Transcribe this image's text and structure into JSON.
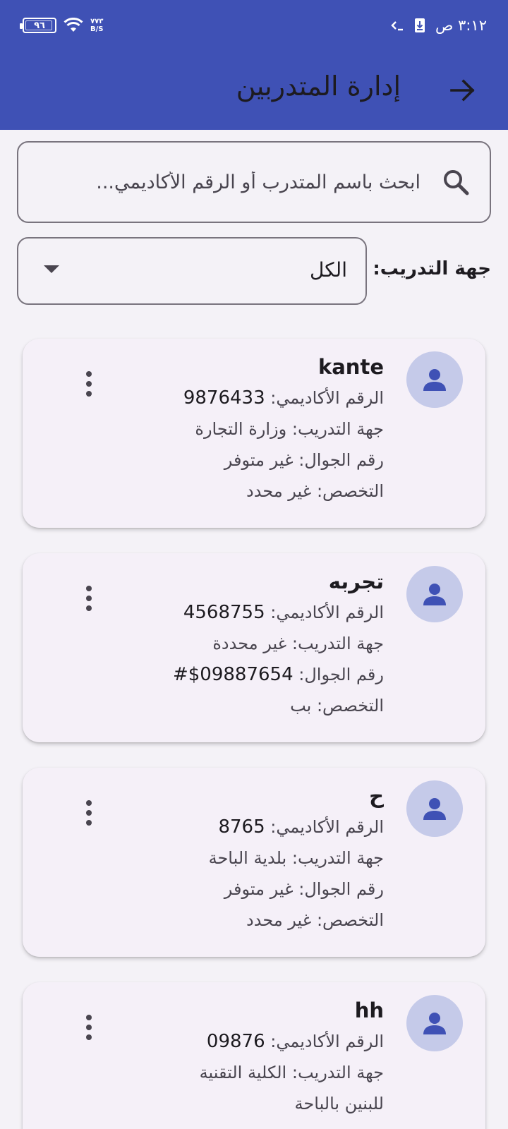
{
  "status_bar": {
    "time": "٣:١٢ ص",
    "battery": "٩٦",
    "net_speed_value": "٧٧٣",
    "net_speed_unit": "B/S"
  },
  "app_bar": {
    "title": "إدارة المتدربين",
    "back_icon": "arrow-right-icon"
  },
  "search": {
    "placeholder": "ابحث باسم المتدرب أو الرقم الأكاديمي...",
    "icon": "search-icon"
  },
  "filter": {
    "label": "جهة التدريب:",
    "selected": "الكل"
  },
  "labels": {
    "academic": "الرقم الأكاديمي: ",
    "entity": "جهة التدريب: ",
    "phone": "رقم الجوال: ",
    "specialty": "التخصص: "
  },
  "trainees": [
    {
      "name": "kante",
      "academic_number": "9876433",
      "entity": "وزارة التجارة",
      "phone": "غير متوفر",
      "specialty": "غير محدد"
    },
    {
      "name": "تجربه",
      "academic_number": "4568755",
      "entity": "غير محددة",
      "phone": "09887654$#",
      "specialty": "بب"
    },
    {
      "name": "ح",
      "academic_number": "8765",
      "entity": "بلدية الباحة",
      "phone": "غير متوفر",
      "specialty": "غير محدد"
    },
    {
      "name": "hh",
      "academic_number": "09876",
      "entity": "الكلية التقنية",
      "entity_cont": "للبنين بالباحة"
    }
  ],
  "colors": {
    "primary": "#3f51b5",
    "avatar_bg": "#c5cae9",
    "card_bg": "#f5f0f8",
    "page_bg": "#f4f2f7"
  }
}
